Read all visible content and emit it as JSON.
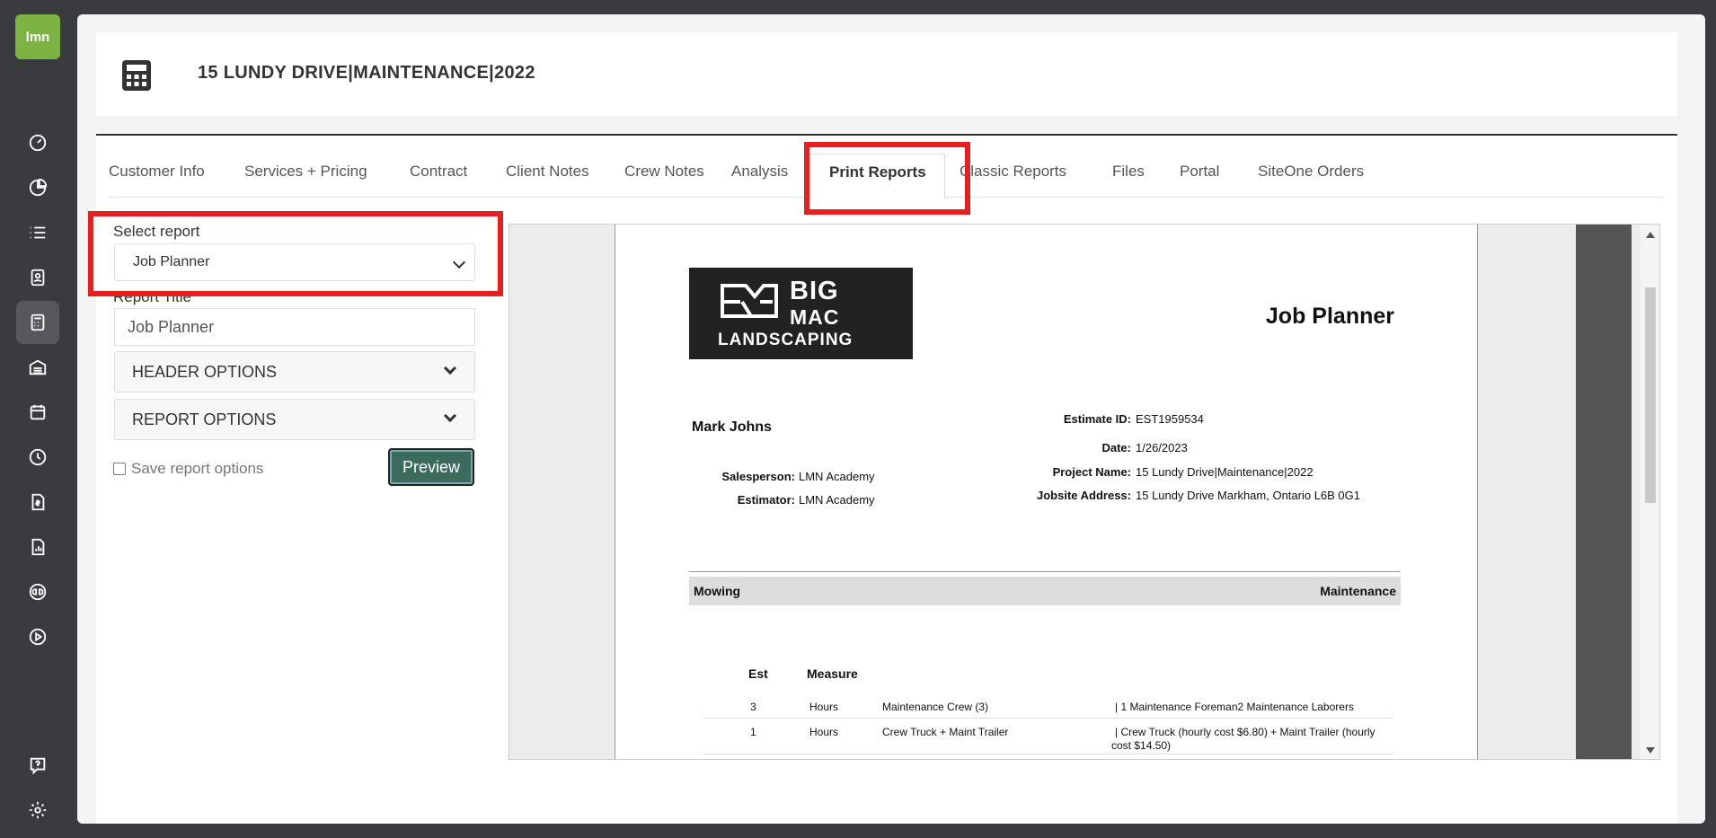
{
  "app": {
    "logo_text": "lmn"
  },
  "sidebar": {
    "items": [
      {
        "name": "dashboard-icon"
      },
      {
        "name": "pie-chart-icon"
      },
      {
        "name": "list-icon"
      },
      {
        "name": "contacts-icon"
      },
      {
        "name": "calculator-icon",
        "active": true
      },
      {
        "name": "warehouse-icon"
      },
      {
        "name": "calendar-icon"
      },
      {
        "name": "clock-icon"
      },
      {
        "name": "invoice-icon"
      },
      {
        "name": "report-icon"
      },
      {
        "name": "quickbooks-icon"
      },
      {
        "name": "play-icon"
      },
      {
        "name": "help-icon"
      },
      {
        "name": "settings-icon"
      }
    ]
  },
  "header": {
    "title": "15 LUNDY DRIVE|MAINTENANCE|2022"
  },
  "tabs": [
    {
      "label": "Customer Info"
    },
    {
      "label": "Services + Pricing"
    },
    {
      "label": "Contract"
    },
    {
      "label": "Client Notes"
    },
    {
      "label": "Crew Notes"
    },
    {
      "label": "Analysis"
    },
    {
      "label": "Print Reports",
      "active": true
    },
    {
      "label": "Classic Reports"
    },
    {
      "label": "Files"
    },
    {
      "label": "Portal"
    },
    {
      "label": "SiteOne Orders"
    }
  ],
  "form": {
    "select_label": "Select report",
    "select_value": "Job Planner",
    "title_label": "Report Title",
    "title_value": "Job Planner",
    "header_options": "HEADER OPTIONS",
    "report_options": "REPORT OPTIONS",
    "save_label": "Save report options",
    "preview_label": "Preview"
  },
  "report": {
    "brand": {
      "big": "BIG",
      "mac": "MAC",
      "landscaping": "LANDSCAPING"
    },
    "title": "Job Planner",
    "client_name": "Mark Johns",
    "salesperson_label": "Salesperson:",
    "salesperson": "LMN Academy",
    "estimator_label": "Estimator:",
    "estimator": "LMN Academy",
    "estimate_id_label": "Estimate ID:",
    "estimate_id": "EST1959534",
    "date_label": "Date:",
    "date": "1/26/2023",
    "project_label": "Project Name:",
    "project": "15 Lundy Drive|Maintenance|2022",
    "jobsite_label": "Jobsite Address:",
    "jobsite": "15 Lundy Drive Markham, Ontario L6B 0G1",
    "section_left": "Mowing",
    "section_right": "Maintenance",
    "table_headers": {
      "est": "Est",
      "measure": "Measure"
    },
    "rows": [
      {
        "est": "3",
        "measure": "Hours",
        "item": "Maintenance Crew (3)",
        "detail": "| 1 Maintenance Foreman2 Maintenance Laborers",
        "detail2": ""
      },
      {
        "est": "1",
        "measure": "Hours",
        "item": "Crew Truck + Maint Trailer",
        "detail": "| Crew Truck (hourly cost $6.80) + Maint Trailer (hourly",
        "detail2": "cost $14.50)"
      }
    ]
  },
  "colors": {
    "brand_green": "#7cb342",
    "highlight_red": "#e81f1f",
    "preview_button": "#3c6a5c"
  }
}
